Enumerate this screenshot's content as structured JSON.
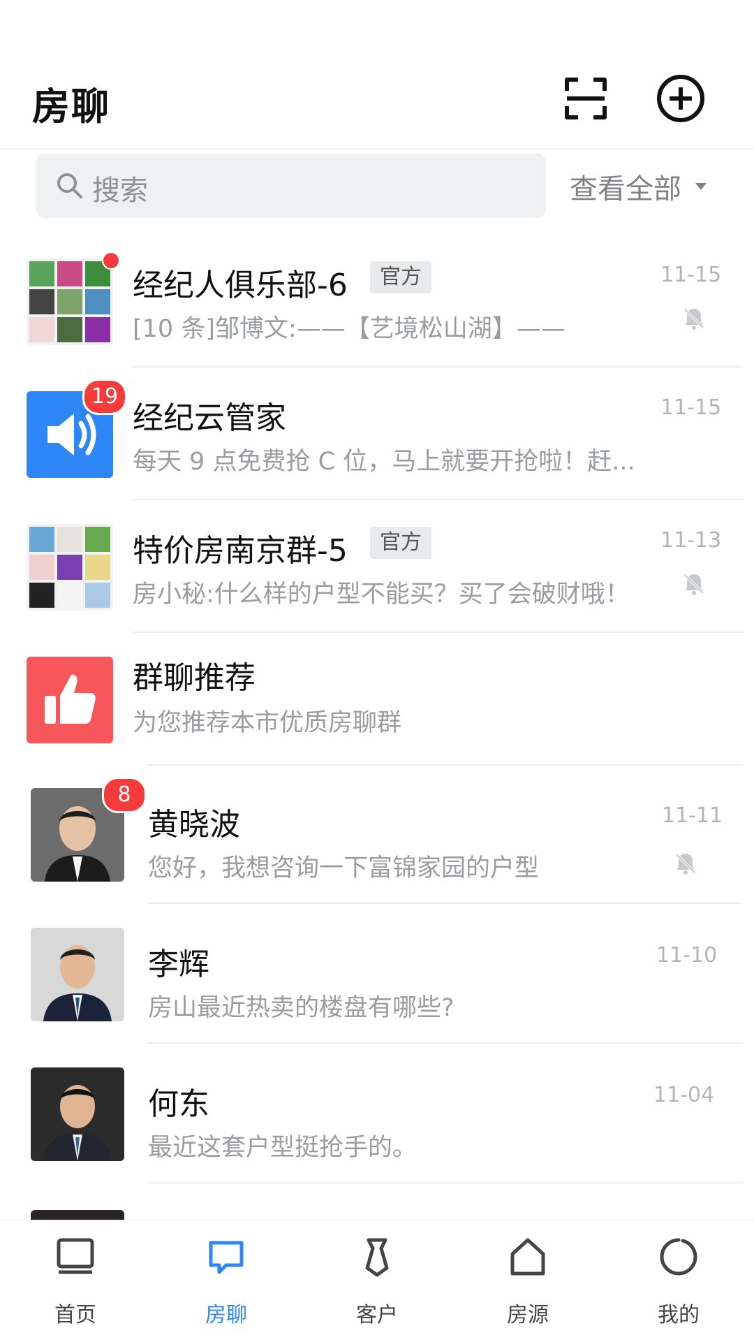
{
  "header": {
    "title": "房聊",
    "scan_icon": "scan-icon",
    "add_icon": "plus-circle-icon"
  },
  "search": {
    "placeholder": "搜索",
    "filter_label": "查看全部"
  },
  "chats": [
    {
      "name": "经纪人俱乐部-6",
      "tag": "官方",
      "preview": "[10 条]邹博文:——【艺境松山湖】——",
      "time": "11-15",
      "muted": true,
      "badge": "dot"
    },
    {
      "name": "经纪云管家",
      "tag": "",
      "preview": "每天 9 点免费抢 C 位，马上就要开抢啦！赶...",
      "time": "11-15",
      "muted": false,
      "badge": "19"
    },
    {
      "name": "特价房南京群-5",
      "tag": "官方",
      "preview": "房小秘:什么样的户型不能买？买了会破财哦！",
      "time": "11-13",
      "muted": true,
      "badge": ""
    },
    {
      "name": "群聊推荐",
      "tag": "",
      "preview": "为您推荐本市优质房聊群",
      "time": "",
      "muted": false,
      "badge": ""
    },
    {
      "name": "黄晓波",
      "tag": "",
      "preview": "您好，我想咨询一下富锦家园的户型",
      "time": "11-11",
      "muted": true,
      "badge": "8"
    },
    {
      "name": "李辉",
      "tag": "",
      "preview": "房山最近热卖的楼盘有哪些?",
      "time": "11-10",
      "muted": false,
      "badge": ""
    },
    {
      "name": "何东",
      "tag": "",
      "preview": "最近这套户型挺抢手的。",
      "time": "11-04",
      "muted": false,
      "badge": ""
    }
  ],
  "tabs": [
    {
      "label": "首页",
      "icon": "home-monitor-icon",
      "active": false
    },
    {
      "label": "房聊",
      "icon": "chat-bubble-icon",
      "active": true
    },
    {
      "label": "客户",
      "icon": "tie-icon",
      "active": false
    },
    {
      "label": "房源",
      "icon": "house-icon",
      "active": false
    },
    {
      "label": "我的",
      "icon": "profile-circle-icon",
      "active": false
    }
  ],
  "colors": {
    "accent": "#2f86f6",
    "badge": "#f53b3b",
    "announce_bg": "#2f86f6",
    "recommend_bg": "#f7575b"
  }
}
